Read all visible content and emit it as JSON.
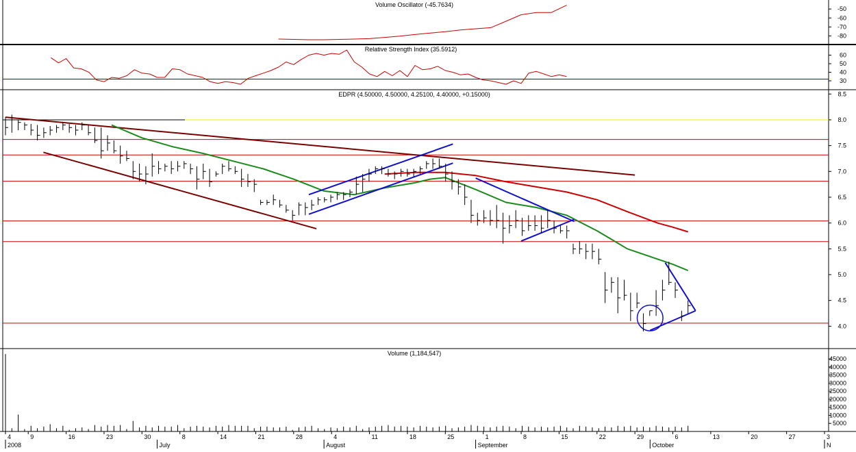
{
  "colors": {
    "price_bars": "#000000",
    "support_lines": "#cc0000",
    "channel_lines": "#1010cc",
    "trendlines": "#7a0000",
    "ma_short": "#1a8a1a",
    "ma_long": "#cc0000",
    "yellow_level": "#f0f000",
    "oscillator_line": "#cc0000",
    "rsi_line": "#cc0000",
    "rsi_threshold": "#1010cc"
  },
  "chart_data": [
    {
      "panel": "volume-oscillator",
      "type": "line",
      "title": "Volume Oscillator (-45.7634)",
      "ylim": [
        -88,
        -40
      ],
      "y_ticks": [
        "-50",
        "-60",
        "-70",
        "-80"
      ],
      "y_tick_values": [
        -50,
        -60,
        -70,
        -80
      ],
      "x": [
        36,
        38,
        40,
        42,
        44,
        46,
        48,
        50,
        52,
        54,
        56,
        58,
        60,
        62,
        64,
        66,
        68,
        70,
        72,
        74
      ],
      "values": [
        -83.4,
        -83.8,
        -84.2,
        -84.2,
        -83.8,
        -83.4,
        -83.0,
        -81.6,
        -80.2,
        -78.4,
        -76.8,
        -75.3,
        -73.4,
        -72.0,
        -70.8,
        -63.6,
        -56.4,
        -53.9,
        -53.9,
        -45.8
      ]
    },
    {
      "panel": "rsi",
      "type": "line",
      "title": "Relative Strength Index (35.5912)",
      "ylim": [
        22,
        70
      ],
      "y_ticks": [
        "60",
        "50",
        "40",
        "30"
      ],
      "y_tick_values": [
        60,
        50,
        40,
        30
      ],
      "threshold": 32,
      "x": [
        6,
        7,
        8,
        9,
        10,
        11,
        12,
        13,
        14,
        15,
        16,
        17,
        18,
        19,
        20,
        21,
        22,
        23,
        24,
        25,
        26,
        27,
        28,
        29,
        30,
        31,
        32,
        33,
        34,
        35,
        36,
        37,
        38,
        39,
        40,
        41,
        42,
        43,
        44,
        45,
        46,
        47,
        48,
        49,
        50,
        51,
        52,
        53,
        54,
        55,
        56,
        57,
        58,
        59,
        60,
        61,
        62,
        63,
        64,
        65,
        66,
        67,
        68,
        69,
        70,
        71,
        72,
        73,
        74
      ],
      "values": [
        57,
        51,
        56,
        45,
        44,
        40,
        31,
        29,
        34,
        33,
        36,
        43,
        39,
        38,
        34,
        34,
        44,
        43,
        38,
        36,
        34,
        29,
        27,
        29,
        28,
        26,
        33,
        36,
        39,
        42,
        46,
        52,
        49,
        55,
        60,
        62,
        60,
        62,
        61,
        66,
        52,
        46,
        38,
        35,
        41,
        36,
        42,
        35,
        48,
        43,
        44,
        47,
        42,
        40,
        37,
        38,
        34,
        31,
        30,
        28,
        26,
        30,
        27,
        39,
        41,
        38,
        35,
        37,
        35
      ]
    },
    {
      "panel": "price",
      "type": "ohlc",
      "title": "EDPR (4.50000, 4.50000, 4.25100, 4.40000, +0.15000)",
      "ylim": [
        3.58,
        8.57
      ],
      "y_ticks": [
        "8.5",
        "8.0",
        "7.5",
        "7.0",
        "6.5",
        "6.0",
        "5.5",
        "5.0",
        "4.5",
        "4.0"
      ],
      "y_tick_values": [
        8.5,
        8.0,
        7.5,
        7.0,
        6.5,
        6.0,
        5.5,
        5.0,
        4.5,
        4.0
      ],
      "ohlc_columns": [
        "high",
        "low",
        "close"
      ],
      "ohlc": [
        [
          8.05,
          7.7,
          7.85
        ],
        [
          8.1,
          7.75,
          8.0
        ],
        [
          8.0,
          7.8,
          7.95
        ],
        [
          7.95,
          7.8,
          7.9
        ],
        [
          7.92,
          7.7,
          7.8
        ],
        [
          7.9,
          7.6,
          7.7
        ],
        [
          7.85,
          7.65,
          7.75
        ],
        [
          7.88,
          7.7,
          7.8
        ],
        [
          7.9,
          7.75,
          7.85
        ],
        [
          7.95,
          7.8,
          7.9
        ],
        [
          7.92,
          7.75,
          7.85
        ],
        [
          7.9,
          7.7,
          7.8
        ],
        [
          7.95,
          7.8,
          7.9
        ],
        [
          7.9,
          7.7,
          7.75
        ],
        [
          7.85,
          7.55,
          7.6
        ],
        [
          7.85,
          7.25,
          7.4
        ],
        [
          7.7,
          7.4,
          7.55
        ],
        [
          7.6,
          7.35,
          7.4
        ],
        [
          7.5,
          7.15,
          7.3
        ],
        [
          7.4,
          7.2,
          7.25
        ],
        [
          7.2,
          6.85,
          7.0
        ],
        [
          7.15,
          6.8,
          6.95
        ],
        [
          7.1,
          6.75,
          6.95
        ],
        [
          7.35,
          6.9,
          7.1
        ],
        [
          7.2,
          6.95,
          7.05
        ],
        [
          7.15,
          7.0,
          7.1
        ],
        [
          7.2,
          6.95,
          7.05
        ],
        [
          7.2,
          7.0,
          7.1
        ],
        [
          7.2,
          7.05,
          7.15
        ],
        [
          7.15,
          6.95,
          7.05
        ],
        [
          7.1,
          6.65,
          6.85
        ],
        [
          7.15,
          6.85,
          7.0
        ],
        [
          7.05,
          6.7,
          6.8
        ],
        [
          7.0,
          6.9,
          6.95
        ],
        [
          7.15,
          6.95,
          7.1
        ],
        [
          7.2,
          7.0,
          7.05
        ],
        [
          7.1,
          6.95,
          7.0
        ],
        [
          7.05,
          6.7,
          6.85
        ],
        [
          6.95,
          6.7,
          6.8
        ],
        [
          6.85,
          6.6,
          6.75
        ],
        [
          6.45,
          6.35,
          6.4
        ],
        [
          6.45,
          6.35,
          6.4
        ],
        [
          6.55,
          6.35,
          6.45
        ],
        [
          6.45,
          6.3,
          6.35
        ],
        [
          6.35,
          6.2,
          6.25
        ],
        [
          6.25,
          6.05,
          6.15
        ],
        [
          6.4,
          6.15,
          6.35
        ],
        [
          6.4,
          6.15,
          6.3
        ],
        [
          6.45,
          6.25,
          6.35
        ],
        [
          6.5,
          6.35,
          6.45
        ],
        [
          6.5,
          6.4,
          6.45
        ],
        [
          6.55,
          6.4,
          6.5
        ],
        [
          6.6,
          6.45,
          6.55
        ],
        [
          6.6,
          6.45,
          6.55
        ],
        [
          6.65,
          6.5,
          6.6
        ],
        [
          6.9,
          6.55,
          6.75
        ],
        [
          6.95,
          6.6,
          6.85
        ],
        [
          7.05,
          6.8,
          6.95
        ],
        [
          7.1,
          6.95,
          7.05
        ],
        [
          7.1,
          6.95,
          7.05
        ],
        [
          7.05,
          6.9,
          6.95
        ],
        [
          7.0,
          6.85,
          6.95
        ],
        [
          7.05,
          6.9,
          7.0
        ],
        [
          7.05,
          6.9,
          6.95
        ],
        [
          7.05,
          6.9,
          7.0
        ],
        [
          7.1,
          6.95,
          7.05
        ],
        [
          7.2,
          7.05,
          7.15
        ],
        [
          7.25,
          7.05,
          7.15
        ],
        [
          7.25,
          7.05,
          7.1
        ],
        [
          7.15,
          6.8,
          6.95
        ],
        [
          7.0,
          6.65,
          6.8
        ],
        [
          6.85,
          6.55,
          6.7
        ],
        [
          6.75,
          6.35,
          6.5
        ],
        [
          6.45,
          6.0,
          6.15
        ],
        [
          6.2,
          5.95,
          6.05
        ],
        [
          6.25,
          6.0,
          6.1
        ],
        [
          6.25,
          5.95,
          6.05
        ],
        [
          6.35,
          5.9,
          6.05
        ],
        [
          6.2,
          5.6,
          5.9
        ],
        [
          6.15,
          5.8,
          5.95
        ],
        [
          6.25,
          5.9,
          6.05
        ],
        [
          6.1,
          5.75,
          5.85
        ],
        [
          6.15,
          5.85,
          5.95
        ],
        [
          6.15,
          5.85,
          5.95
        ],
        [
          6.15,
          5.8,
          5.9
        ],
        [
          6.25,
          5.9,
          6.05
        ],
        [
          6.05,
          5.8,
          5.9
        ],
        [
          5.95,
          5.8,
          5.85
        ],
        [
          5.95,
          5.7,
          5.85
        ],
        [
          5.6,
          5.4,
          5.5
        ],
        [
          5.65,
          5.4,
          5.5
        ],
        [
          5.6,
          5.3,
          5.45
        ],
        [
          5.6,
          5.3,
          5.45
        ],
        [
          5.5,
          5.2,
          5.3
        ],
        [
          5.05,
          4.45,
          4.7
        ],
        [
          4.95,
          4.65,
          4.85
        ],
        [
          4.95,
          4.25,
          4.55
        ],
        [
          4.9,
          4.5,
          4.6
        ],
        [
          4.65,
          4.1,
          4.3
        ],
        [
          4.65,
          4.35,
          4.45
        ],
        [
          4.25,
          3.9,
          4.05
        ],
        [
          4.3,
          4.2,
          4.3
        ],
        [
          4.7,
          4.2,
          4.4
        ],
        [
          4.9,
          4.5,
          4.7
        ],
        [
          5.25,
          4.8,
          4.85
        ],
        [
          4.85,
          4.55,
          4.7
        ],
        [
          4.3,
          4.1,
          4.2
        ],
        [
          4.5,
          4.25,
          4.4
        ]
      ],
      "moving_average_short": [
        [
          14,
          7.9
        ],
        [
          18,
          7.65
        ],
        [
          22,
          7.48
        ],
        [
          26,
          7.35
        ],
        [
          30,
          7.2
        ],
        [
          34,
          7.05
        ],
        [
          38,
          6.85
        ],
        [
          42,
          6.62
        ],
        [
          46,
          6.55
        ],
        [
          50,
          6.68
        ],
        [
          54,
          6.78
        ],
        [
          56,
          6.85
        ],
        [
          58,
          6.88
        ],
        [
          62,
          6.65
        ],
        [
          66,
          6.4
        ],
        [
          70,
          6.3
        ],
        [
          74,
          6.15
        ],
        [
          78,
          5.85
        ],
        [
          82,
          5.5
        ],
        [
          86,
          5.3
        ],
        [
          88,
          5.2
        ],
        [
          90,
          5.08
        ]
      ],
      "moving_average_long": [
        [
          50,
          6.95
        ],
        [
          54,
          6.98
        ],
        [
          58,
          6.98
        ],
        [
          62,
          6.92
        ],
        [
          66,
          6.8
        ],
        [
          70,
          6.7
        ],
        [
          74,
          6.6
        ],
        [
          78,
          6.45
        ],
        [
          82,
          6.22
        ],
        [
          86,
          6.0
        ],
        [
          88,
          5.92
        ],
        [
          90,
          5.83
        ]
      ],
      "horizontal_levels": [
        8.0,
        7.62,
        7.32,
        6.81,
        6.04,
        5.64,
        4.06
      ],
      "yellow_level": 8.0,
      "trendlines": [
        {
          "from": [
            0,
            8.05
          ],
          "to": [
            83,
            6.93
          ]
        },
        {
          "from": [
            5,
            7.37
          ],
          "to": [
            41,
            5.89
          ]
        }
      ],
      "channels": [
        {
          "from": [
            40,
            6.17
          ],
          "to": [
            59,
            7.16
          ]
        },
        {
          "from": [
            40,
            6.55
          ],
          "to": [
            59,
            7.53
          ]
        },
        {
          "from": [
            68,
            5.65
          ],
          "to": [
            75,
            6.07
          ]
        },
        {
          "from": [
            62,
            6.87
          ],
          "to": [
            75,
            6.03
          ]
        },
        {
          "from": [
            87,
            5.23
          ],
          "to": [
            91,
            4.3
          ]
        },
        {
          "from": [
            85,
            3.92
          ],
          "to": [
            91,
            4.3
          ]
        }
      ],
      "circle": {
        "center": [
          85,
          4.16
        ],
        "radius_values": 0.25
      }
    },
    {
      "panel": "volume",
      "type": "bar",
      "title": "Volume (1,184,547)",
      "ylim": [
        0,
        48000
      ],
      "y_ticks": [
        "45000",
        "40000",
        "35000",
        "30000",
        "25000",
        "20000",
        "15000",
        "10000",
        "5000"
      ],
      "y_tick_values": [
        45000,
        40000,
        35000,
        30000,
        25000,
        20000,
        15000,
        10000,
        5000
      ],
      "values": [
        48000,
        2000,
        10500,
        1500,
        3500,
        2000,
        3000,
        4500,
        2000,
        3500,
        1000,
        2000,
        2500,
        1500,
        4000,
        3000,
        4000,
        3500,
        4000,
        1500,
        6500,
        2500,
        3500,
        2500,
        3500,
        3000,
        3000,
        4000,
        2000,
        3000,
        3500,
        3000,
        2500,
        3500,
        3000,
        4000,
        3500,
        3500,
        3500,
        2000,
        3000,
        3000,
        2500,
        2500,
        3000,
        1000,
        2500,
        3000,
        3500,
        2000,
        1500,
        2500,
        2000,
        3000,
        2500,
        3500,
        1500,
        2500,
        3000,
        3500,
        4000,
        3000,
        3500,
        3000,
        2500,
        3500,
        3000,
        2500,
        3000,
        3500,
        2000,
        2500,
        3000,
        4000,
        3500,
        3000,
        2500,
        3000,
        3500,
        3000,
        2000,
        3500,
        3000,
        2500,
        3000,
        2500,
        3000,
        3500,
        2500,
        2000,
        3500,
        3000,
        2500,
        2000,
        3000,
        2500,
        3500,
        3000,
        3500,
        2500,
        3000,
        2500,
        3500,
        3000,
        2500,
        3000,
        2500,
        3500
      ]
    }
  ],
  "x_axis": {
    "ticks": [
      {
        "label": "4",
        "day": 0
      },
      {
        "label": "9",
        "day": 3
      },
      {
        "label": "16",
        "day": 8
      },
      {
        "label": "23",
        "day": 13
      },
      {
        "label": "30",
        "day": 18
      },
      {
        "label": "8",
        "day": 23
      },
      {
        "label": "14",
        "day": 28
      },
      {
        "label": "21",
        "day": 33
      },
      {
        "label": "28",
        "day": 38
      },
      {
        "label": "4",
        "day": 43
      },
      {
        "label": "11",
        "day": 48
      },
      {
        "label": "18",
        "day": 53
      },
      {
        "label": "25",
        "day": 58
      },
      {
        "label": "1",
        "day": 63
      },
      {
        "label": "8",
        "day": 68
      },
      {
        "label": "15",
        "day": 73
      },
      {
        "label": "22",
        "day": 78
      },
      {
        "label": "29",
        "day": 83
      },
      {
        "label": "6",
        "day": 88
      },
      {
        "label": "13",
        "day": 93
      },
      {
        "label": "20",
        "day": 98
      },
      {
        "label": "27",
        "day": 103
      },
      {
        "label": "3",
        "day": 108
      }
    ],
    "months": [
      {
        "label": "2008",
        "day": 0
      },
      {
        "label": "July",
        "day": 20
      },
      {
        "label": "August",
        "day": 42
      },
      {
        "label": "September",
        "day": 62
      },
      {
        "label": "October",
        "day": 85
      },
      {
        "label": "N",
        "day": 108
      }
    ]
  }
}
